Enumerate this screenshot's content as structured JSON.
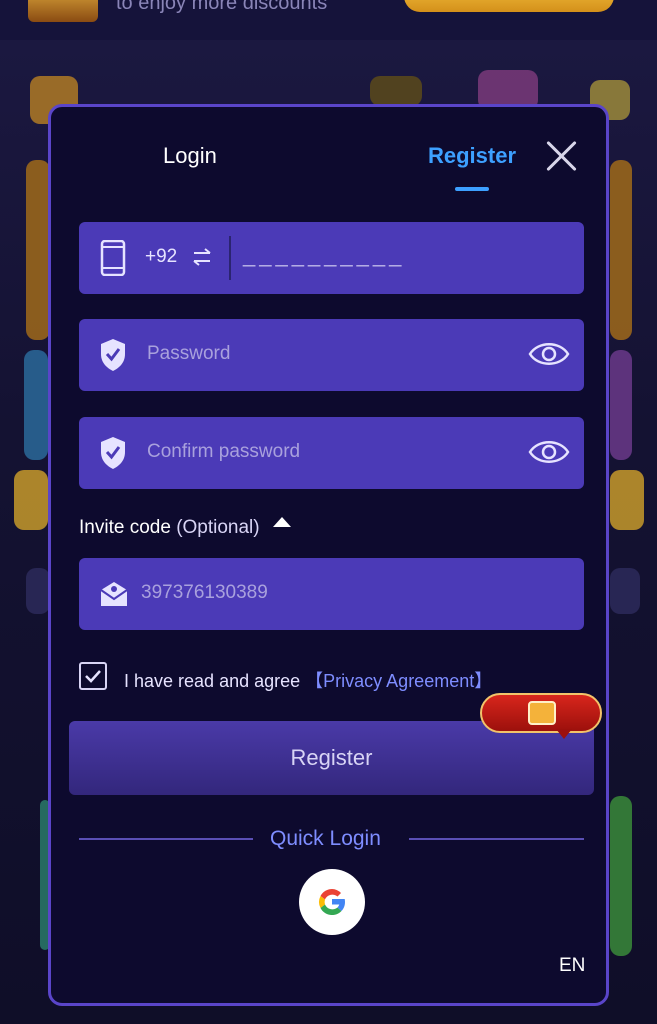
{
  "background": {
    "promo_text": "to enjoy more discounts"
  },
  "modal": {
    "tabs": {
      "login": "Login",
      "register": "Register"
    },
    "phone": {
      "country_code": "+92",
      "placeholder": "__________"
    },
    "password": {
      "placeholder": "Password"
    },
    "confirm_password": {
      "placeholder": "Confirm password"
    },
    "invite": {
      "label": "Invite code",
      "optional": "(Optional)",
      "value": "397376130389"
    },
    "agreement": {
      "text": "I have read and agree",
      "link": "【Privacy Agreement】",
      "checked": true
    },
    "register_button": "Register",
    "quick_login": "Quick Login",
    "language": "EN"
  },
  "colors": {
    "accent_blue": "#3da0ff",
    "field_bg": "#4b3ab7",
    "modal_border": "#5a45c9",
    "link": "#7e8dff"
  },
  "icons": [
    "phone-icon",
    "swap-icon",
    "shield-check-icon",
    "eye-icon",
    "envelope-icon",
    "check-icon",
    "gift-icon",
    "google-icon",
    "close-icon"
  ]
}
